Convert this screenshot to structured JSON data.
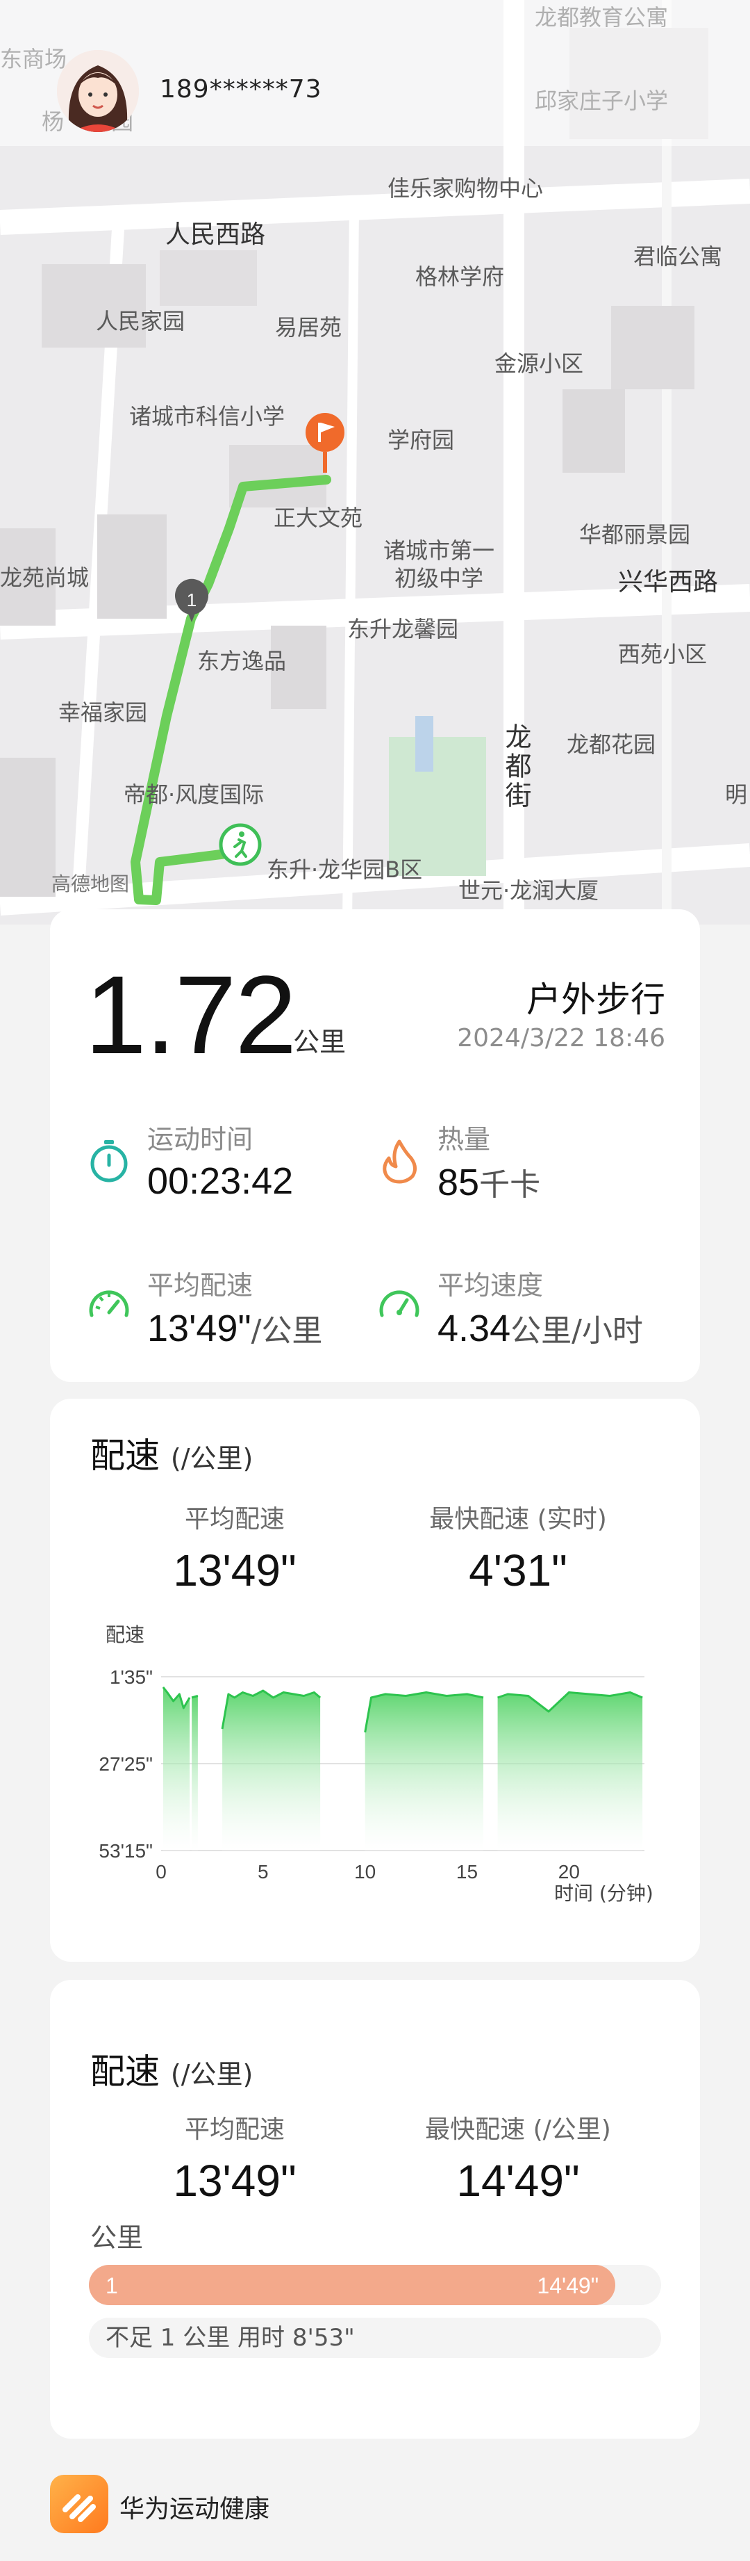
{
  "user": {
    "phone": "189******73"
  },
  "map": {
    "labels": {
      "renmin_west_road": "人民西路",
      "jialejia": "佳乐家购物中心",
      "qiujiazhuang_school": "邱家庄子小学",
      "gelin": "格林学府",
      "junlin": "君临公寓",
      "renmin_home": "人民家园",
      "yijuyuan": "易居苑",
      "jinyuan": "金源小区",
      "kexin_school": "诸城市科信小学",
      "xuefu": "学府园",
      "zhengda": "正大文苑",
      "no1_junior": "诸城市第一\n初级中学",
      "huadu_lijing": "华都丽景园",
      "shang_cheng": "龙苑尚城",
      "xinghua_west_road": "兴华西路",
      "dongsheng_longxin": "东升龙馨园",
      "dongfang_yipin": "东方逸品",
      "xiyuan": "西苑小区",
      "xingfu": "幸福家园",
      "longdu_jie": "龙都街",
      "longdu_garden": "龙都花园",
      "dedu_fengdu": "帝都·风度国际",
      "dongsheng_longhua": "东升·龙华园B区",
      "gaode": "高德地图",
      "shiyuan_longrun": "世元·龙润大厦",
      "ming": "明",
      "top_left": "东商场",
      "top_left2": "杨",
      "top_left3": "园",
      "top_right": "龙都教育公寓"
    },
    "km_marker": "1"
  },
  "summary": {
    "distance": "1.72",
    "distance_unit": "公里",
    "activity": "户外步行",
    "datetime": "2024/3/22 18:46",
    "stats": {
      "duration_label": "运动时间",
      "duration": "00:23:42",
      "calories_label": "热量",
      "calories": "85",
      "calories_unit": "千卡",
      "avg_pace_label": "平均配速",
      "avg_pace": "13'49\"",
      "avg_pace_unit": "/公里",
      "avg_speed_label": "平均速度",
      "avg_speed": "4.34",
      "avg_speed_unit": "公里/小时"
    },
    "colors": {
      "accent": "#3fc65a",
      "teal": "#27b3a4",
      "orange": "#f08a4b",
      "route": "#6ccf5a"
    }
  },
  "pace_card": {
    "title": "配速",
    "title_sub": "(/公里)",
    "avg_label": "平均配速",
    "avg_value": "13'49\"",
    "fast_label": "最快配速 (实时)",
    "fast_value": "4'31\"",
    "chart_ylabel": "配速",
    "chart_xlabel": "时间 (分钟)"
  },
  "chart_data": {
    "type": "area",
    "title": "",
    "ylabel": "配速",
    "xlabel": "时间 (分钟)",
    "y_ticks": [
      "1'35\"",
      "27'25\"",
      "53'15\""
    ],
    "x_ticks": [
      0,
      5,
      10,
      15,
      20
    ],
    "x_range": [
      0,
      23.7
    ],
    "y_inverted": true,
    "segments": [
      {
        "x": [
          0.1,
          0.3,
          0.6,
          0.9,
          1.1,
          1.4
        ],
        "y": [
          6,
          9,
          14,
          10,
          18,
          12
        ]
      },
      {
        "x": [
          1.5,
          1.8
        ],
        "y": [
          12,
          11
        ]
      },
      {
        "x": [
          3.0,
          3.3,
          3.6,
          4.0,
          4.5,
          5.0,
          5.5,
          6.0,
          6.5,
          7.0,
          7.5,
          7.8
        ],
        "y": [
          30,
          10,
          12,
          9,
          11,
          8,
          12,
          9,
          10,
          11,
          9,
          12
        ]
      },
      {
        "x": [
          10.0,
          10.3,
          11.0,
          12.0,
          13.0,
          14.0,
          15.0,
          15.8
        ],
        "y": [
          32,
          12,
          10,
          11,
          9,
          11,
          10,
          12
        ]
      },
      {
        "x": [
          16.5,
          17.0,
          18.0,
          19.0,
          20.0,
          21.0,
          22.0,
          23.0,
          23.6
        ],
        "y": [
          12,
          10,
          11,
          20,
          9,
          10,
          11,
          9,
          12
        ]
      }
    ],
    "fastest": "4'31\"",
    "average": "13'49\"",
    "colors": {
      "line": "#2dc44e",
      "fill_top": "#58d46a",
      "fill_bottom": "#ffffff"
    }
  },
  "km_card": {
    "title": "配速",
    "title_sub": "(/公里)",
    "avg_label": "平均配速",
    "avg_value": "13'49\"",
    "fast_label": "最快配速 (/公里)",
    "fast_value": "14'49\"",
    "km_label": "公里",
    "rows": [
      {
        "km": "1",
        "pace": "14'49\"",
        "fraction": 0.92
      }
    ],
    "note": "不足 1 公里 用时 8'53\""
  },
  "footer": {
    "app_name": "华为运动健康"
  }
}
